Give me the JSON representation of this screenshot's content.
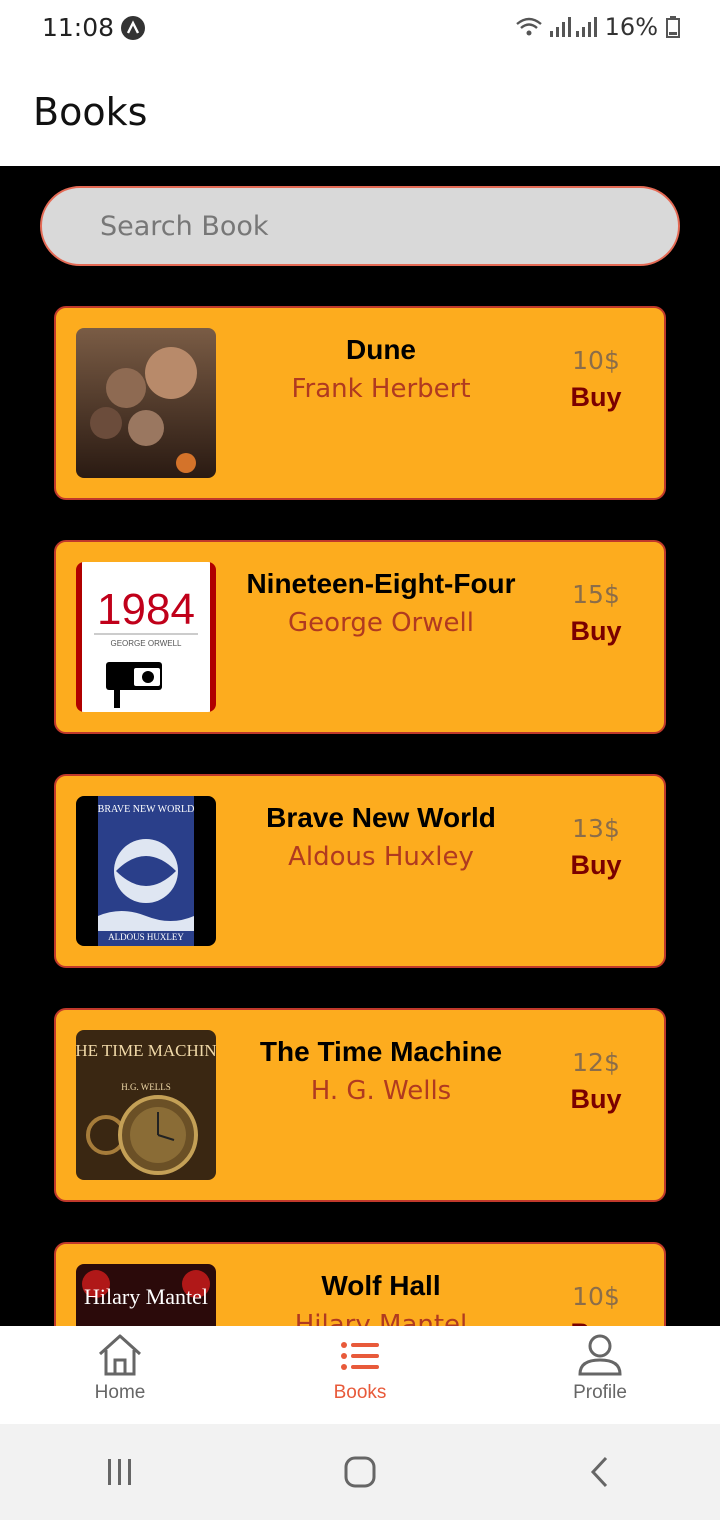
{
  "status_bar": {
    "time": "11:08",
    "battery": "16%"
  },
  "header": {
    "title": "Books"
  },
  "search": {
    "placeholder": "Search Book"
  },
  "books": [
    {
      "title": "Dune",
      "author": "Frank Herbert",
      "price": "10$",
      "buy_label": "Buy",
      "cover_icon": "dune-cover-image"
    },
    {
      "title": "Nineteen-Eight-Four",
      "author": "George Orwell",
      "price": "15$",
      "buy_label": "Buy",
      "cover_icon": "1984-cover-image",
      "cover_text": "1984",
      "cover_subtext": "GEORGE ORWELL"
    },
    {
      "title": "Brave New World",
      "author": "Aldous Huxley",
      "price": "13$",
      "buy_label": "Buy",
      "cover_icon": "brave-new-world-cover-image",
      "cover_text": "BRAVE NEW WORLD",
      "cover_subtext": "ALDOUS HUXLEY"
    },
    {
      "title": "The Time Machine",
      "author": "H. G. Wells",
      "price": "12$",
      "buy_label": "Buy",
      "cover_icon": "time-machine-cover-image",
      "cover_text": "THE TIME MACHINE",
      "cover_subtext": "H.G. WELLS"
    },
    {
      "title": "Wolf Hall",
      "author": "Hilary Mantel",
      "price": "10$",
      "buy_label": "Buy",
      "cover_icon": "wolf-hall-cover-image",
      "cover_text": "Hilary Mantel"
    }
  ],
  "bottom_nav": {
    "items": [
      {
        "label": "Home",
        "icon": "home-icon"
      },
      {
        "label": "Books",
        "icon": "list-icon",
        "active": true
      },
      {
        "label": "Profile",
        "icon": "user-icon"
      }
    ]
  },
  "colors": {
    "card_bg": "#fdac1e",
    "card_border": "#c0392b",
    "accent": "#e85a3a",
    "author": "#b03a20",
    "buy": "#7a0000"
  }
}
